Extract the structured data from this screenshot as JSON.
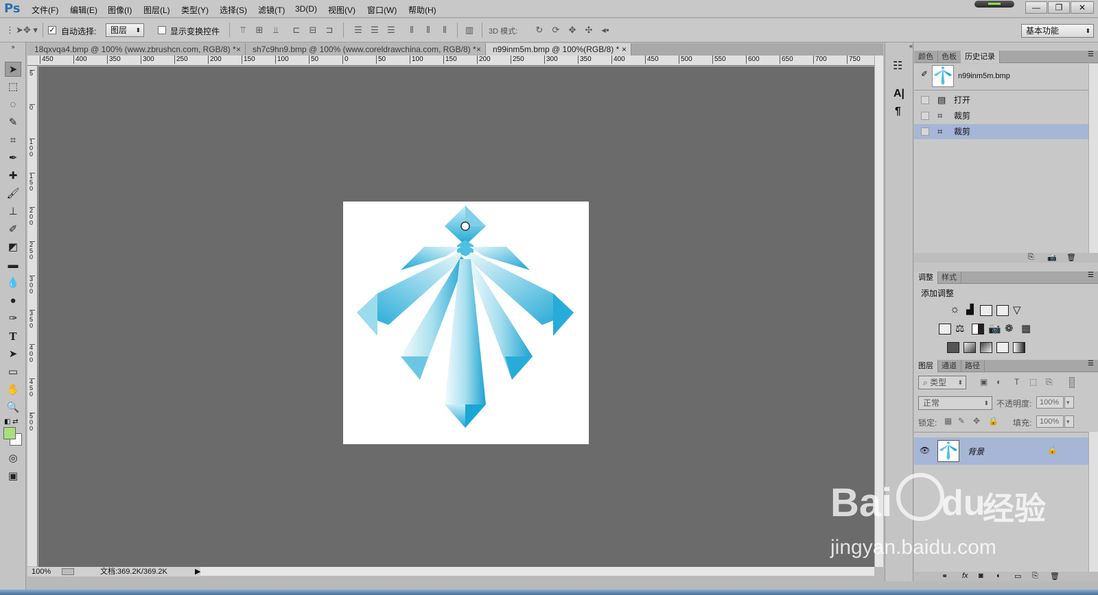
{
  "app": {
    "logo": "Ps"
  },
  "menubar": {
    "items": [
      "文件(F)",
      "编辑(E)",
      "图像(I)",
      "图层(L)",
      "类型(Y)",
      "选择(S)",
      "滤镜(T)",
      "3D(D)",
      "视图(V)",
      "窗口(W)",
      "帮助(H)"
    ],
    "window_buttons": {
      "minimize": "—",
      "restore": "❐",
      "close": "✕"
    }
  },
  "options": {
    "auto_select_label": "自动选择:",
    "auto_select_checked": true,
    "auto_select_target": "图层",
    "show_transform_label": "显示变换控件",
    "show_transform_checked": false,
    "mode_3d_label": "3D 模式:",
    "workspace": "基本功能"
  },
  "tabs": [
    {
      "label": "18qxvqa4.bmp @ 100% (www.zbrushcn.com, RGB/8) *",
      "close": "×"
    },
    {
      "label": "sh7c9hn9.bmp @ 100% (www.coreldrawchina.com, RGB/8) *",
      "close": "×"
    },
    {
      "label": "n99inm5m.bmp @ 100%(RGB/8) *",
      "close": "×"
    }
  ],
  "ruler_top_labels": [
    "450",
    "400",
    "350",
    "300",
    "250",
    "200",
    "150",
    "100",
    "50",
    "0",
    "50",
    "100",
    "150",
    "200",
    "250",
    "300",
    "350",
    "400",
    "450",
    "500",
    "550",
    "600",
    "650",
    "700",
    "750"
  ],
  "ruler_left_labels": [
    "5",
    "0",
    "1 0 0",
    "1 5 0",
    "2 0 0",
    "2 5 0",
    "3 0 0",
    "3 5 0",
    "4 0 0",
    "4 5 0",
    "5 0 0"
  ],
  "status": {
    "zoom": "100%",
    "doc_info": "文档:369.2K/369.2K"
  },
  "history_panel": {
    "tabs": [
      "颜色",
      "色板",
      "历史记录"
    ],
    "active_tab": "历史记录",
    "snapshot_name": "n99inm5m.bmp",
    "items": [
      {
        "label": "打开",
        "icon": "document-icon",
        "selected": false
      },
      {
        "label": "裁剪",
        "icon": "crop-icon",
        "selected": false
      },
      {
        "label": "裁剪",
        "icon": "crop-icon",
        "selected": true
      }
    ]
  },
  "adjustments_panel": {
    "tabs": [
      "调整",
      "样式"
    ],
    "title": "添加调整"
  },
  "layers_panel": {
    "tabs": [
      "图层",
      "通道",
      "路径"
    ],
    "filter_label": "类型",
    "blend_mode": "正常",
    "opacity_label": "不透明度:",
    "opacity_value": "100%",
    "lock_label": "锁定:",
    "fill_label": "填充:",
    "fill_value": "100%",
    "layers": [
      {
        "name": "背景",
        "visible": true,
        "locked": true
      }
    ]
  },
  "watermark": {
    "brand": "Bai",
    "suffix": "du",
    "cn": "经验",
    "url": "jingyan.baidu.com"
  },
  "colors": {
    "foreground": "#a8e07e",
    "background": "#ffffff",
    "crystal_light": "#d9f2f8",
    "crystal_dark": "#1aa7d6"
  }
}
